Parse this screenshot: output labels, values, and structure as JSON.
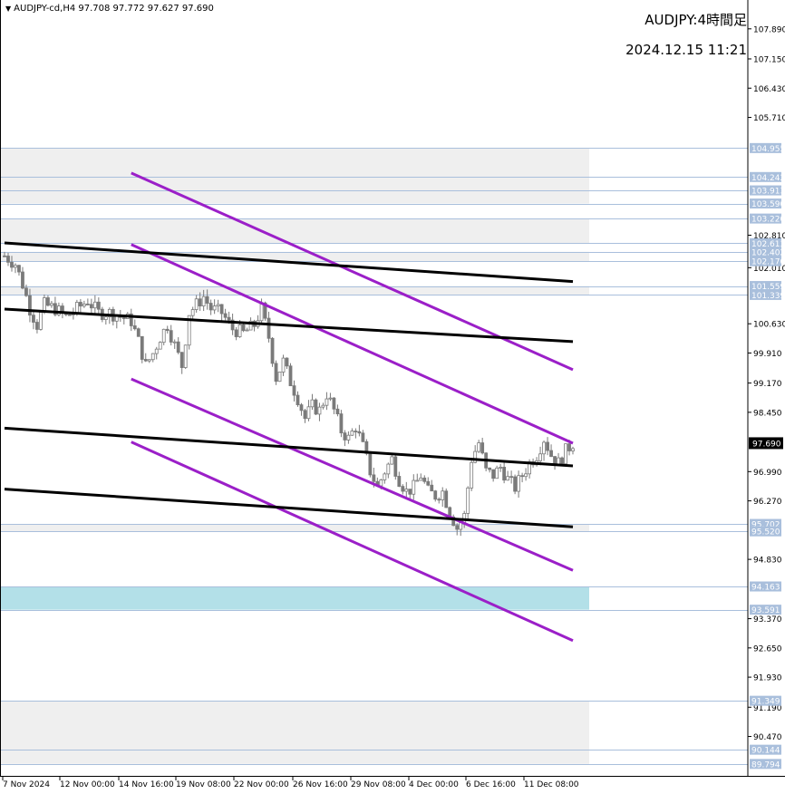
{
  "header": {
    "symbol_line": "AUDJPY-cd,H4  97.708 97.772 97.627 97.690",
    "title": "AUDJPY:4時間足",
    "datetime": "2024.12.15 11:21"
  },
  "colors": {
    "background": "#ffffff",
    "zone_gray": "#efefef",
    "zone_blue": "#b3e0e8",
    "level_line": "#a9bfdc",
    "level_label_bg": "#a9bfdc",
    "channel_purple": "#9b1fc8",
    "trend_black": "#000000",
    "candle": "#7a7a7a",
    "price_label_bg": "#000000"
  },
  "chart_data": {
    "type": "candlestick",
    "symbol": "AUDJPY-cd",
    "timeframe": "H4",
    "ohlc": {
      "open": 97.708,
      "high": 97.772,
      "low": 97.627,
      "close": 97.69
    },
    "ylim": [
      89.5,
      108.6
    ],
    "y_ticks": [
      "107.890",
      "107.150",
      "106.430",
      "105.710",
      "102.810",
      "102.010",
      "100.630",
      "99.910",
      "99.170",
      "98.450",
      "96.990",
      "96.270",
      "94.830",
      "93.370",
      "92.650",
      "91.930",
      "91.190",
      "90.470"
    ],
    "level_labels": [
      "104.955",
      "104.242",
      "103.913",
      "103.590",
      "103.220",
      "102.613",
      "102.402",
      "102.170",
      "101.559",
      "101.339",
      "95.702",
      "95.520",
      "94.163",
      "93.591",
      "91.349",
      "90.144",
      "89.794"
    ],
    "x_ticks": [
      "7 Nov 2024",
      "12 Nov 00:00",
      "14 Nov 16:00",
      "19 Nov 08:00",
      "22 Nov 00:00",
      "26 Nov 16:00",
      "29 Nov 08:00",
      "4 Dec 00:00",
      "6 Dec 16:00",
      "11 Dec 08:00"
    ],
    "x_range": [
      0,
      159
    ],
    "current_price": "97.690",
    "zones": [
      {
        "color": "gray",
        "from": 104.242,
        "to": 104.955
      },
      {
        "color": "gray",
        "from": 103.913,
        "to": 104.242
      },
      {
        "color": "gray",
        "from": 103.59,
        "to": 103.913
      },
      {
        "color": "gray",
        "from": 102.613,
        "to": 103.22
      },
      {
        "color": "gray",
        "from": 102.17,
        "to": 102.402
      },
      {
        "color": "gray",
        "from": 101.339,
        "to": 101.559
      },
      {
        "color": "gray",
        "from": 95.52,
        "to": 95.702
      },
      {
        "color": "blue",
        "from": 93.591,
        "to": 94.163
      },
      {
        "color": "gray",
        "from": 90.144,
        "to": 91.349
      },
      {
        "color": "gray",
        "from": 89.794,
        "to": 90.144
      }
    ],
    "trend_lines": [
      {
        "color": "purple",
        "x1": 35,
        "y1": 104.34,
        "x2": 157,
        "y2": 99.5
      },
      {
        "color": "purple",
        "x1": 35,
        "y1": 102.58,
        "x2": 157,
        "y2": 97.69
      },
      {
        "color": "purple",
        "x1": 35,
        "y1": 99.27,
        "x2": 157,
        "y2": 94.56
      },
      {
        "color": "purple",
        "x1": 35,
        "y1": 97.72,
        "x2": 157,
        "y2": 92.83
      },
      {
        "color": "black",
        "x1": 0,
        "y1": 102.62,
        "x2": 157,
        "y2": 101.67
      },
      {
        "color": "black",
        "x1": 0,
        "y1": 100.99,
        "x2": 157,
        "y2": 100.19
      },
      {
        "color": "black",
        "x1": 0,
        "y1": 98.06,
        "x2": 157,
        "y2": 97.13
      },
      {
        "color": "black",
        "x1": 0,
        "y1": 96.56,
        "x2": 157,
        "y2": 95.63
      }
    ],
    "close_path": [
      [
        0,
        102.3
      ],
      [
        3,
        102.1
      ],
      [
        5,
        101.6
      ],
      [
        7,
        101.0
      ],
      [
        9,
        100.6
      ],
      [
        11,
        101.1
      ],
      [
        14,
        101.0
      ],
      [
        17,
        100.8
      ],
      [
        20,
        101.0
      ],
      [
        23,
        101.2
      ],
      [
        26,
        100.9
      ],
      [
        29,
        100.9
      ],
      [
        32,
        100.8
      ],
      [
        35,
        100.7
      ],
      [
        37,
        100.2
      ],
      [
        39,
        99.6
      ],
      [
        41,
        99.9
      ],
      [
        43,
        100.3
      ],
      [
        45,
        100.6
      ],
      [
        47,
        100.1
      ],
      [
        49,
        99.6
      ],
      [
        51,
        100.9
      ],
      [
        53,
        101.1
      ],
      [
        55,
        101.3
      ],
      [
        57,
        101.0
      ],
      [
        60,
        100.9
      ],
      [
        63,
        100.5
      ],
      [
        66,
        100.4
      ],
      [
        69,
        100.6
      ],
      [
        71,
        101.0
      ],
      [
        73,
        100.3
      ],
      [
        75,
        99.3
      ],
      [
        77,
        99.7
      ],
      [
        79,
        99.2
      ],
      [
        81,
        98.8
      ],
      [
        83,
        98.3
      ],
      [
        85,
        98.6
      ],
      [
        87,
        98.5
      ],
      [
        89,
        98.9
      ],
      [
        91,
        98.5
      ],
      [
        93,
        98.0
      ],
      [
        95,
        97.8
      ],
      [
        97,
        98.1
      ],
      [
        99,
        97.6
      ],
      [
        101,
        97.0
      ],
      [
        103,
        96.6
      ],
      [
        105,
        97.0
      ],
      [
        107,
        97.3
      ],
      [
        109,
        96.8
      ],
      [
        111,
        96.5
      ],
      [
        113,
        96.6
      ],
      [
        115,
        96.9
      ],
      [
        117,
        96.5
      ],
      [
        119,
        96.4
      ],
      [
        121,
        96.5
      ],
      [
        123,
        96.0
      ],
      [
        125,
        95.6
      ],
      [
        127,
        95.9
      ],
      [
        129,
        97.3
      ],
      [
        131,
        97.7
      ],
      [
        133,
        97.0
      ],
      [
        135,
        96.9
      ],
      [
        137,
        97.1
      ],
      [
        139,
        96.8
      ],
      [
        141,
        96.6
      ],
      [
        143,
        96.9
      ],
      [
        145,
        97.2
      ],
      [
        147,
        97.4
      ],
      [
        149,
        97.8
      ],
      [
        151,
        97.4
      ],
      [
        153,
        97.2
      ],
      [
        155,
        97.5
      ],
      [
        157,
        97.69
      ]
    ]
  }
}
